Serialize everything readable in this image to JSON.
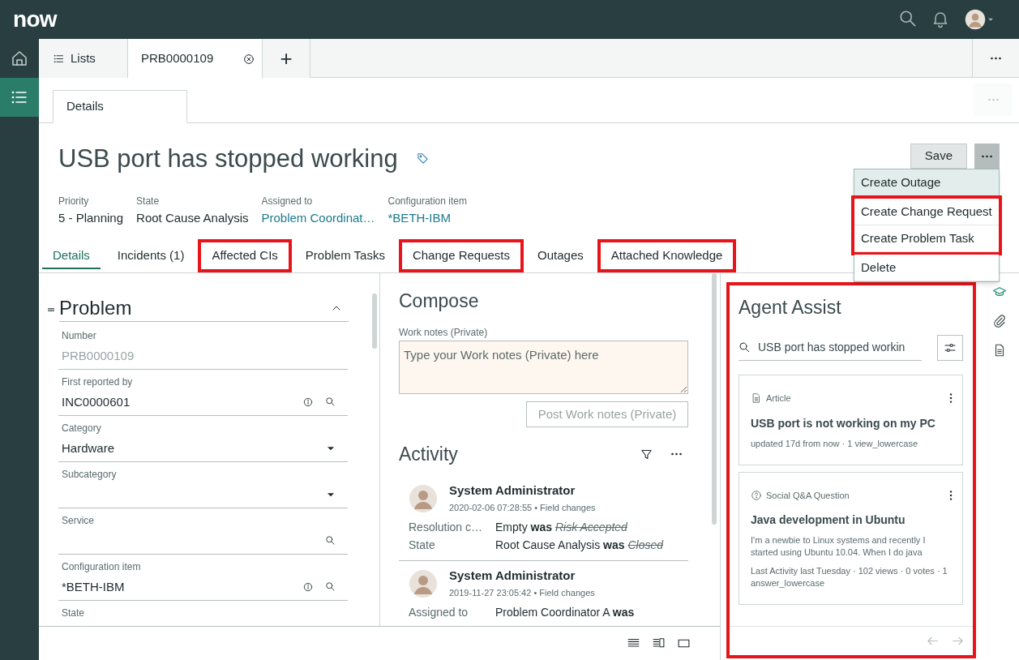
{
  "app": {
    "logo": "now"
  },
  "nav_rail": [
    {
      "kind": "home",
      "selected": false
    },
    {
      "kind": "list",
      "selected": true
    }
  ],
  "workspace_tabs": [
    {
      "kind": "list",
      "label": "Lists",
      "selected": false
    },
    {
      "kind": "record",
      "label": "PRB0000109",
      "selected": true
    },
    {
      "kind": "add",
      "label": "+",
      "selected": false
    }
  ],
  "page_tabs": [
    {
      "label": "Details",
      "selected": true
    }
  ],
  "record": {
    "title": "USB port has stopped working",
    "save_button": "Save",
    "fields": [
      {
        "label": "Priority",
        "value": "5 - Planning",
        "kind": "text"
      },
      {
        "label": "State",
        "value": "Root Cause Analysis",
        "kind": "text"
      },
      {
        "label": "Assigned to",
        "value": "Problem Coordinat…",
        "kind": "link"
      },
      {
        "label": "Configuration item",
        "value": "*BETH-IBM",
        "kind": "link"
      }
    ]
  },
  "action_menu": [
    {
      "label": "Create Outage",
      "hovered": true,
      "outlined": false
    },
    {
      "label": "Create Change Request",
      "hovered": false,
      "outlined": true
    },
    {
      "label": "Create Problem Task",
      "hovered": false,
      "outlined": true
    },
    {
      "label": "Delete",
      "hovered": false,
      "outlined": false
    }
  ],
  "record_tabs": [
    {
      "label": "Details",
      "selected": true,
      "outlined": false
    },
    {
      "label": "Incidents (1)",
      "selected": false,
      "outlined": false
    },
    {
      "label": "Affected CIs",
      "selected": false,
      "outlined": true
    },
    {
      "label": "Problem Tasks",
      "selected": false,
      "outlined": false
    },
    {
      "label": "Change Requests",
      "selected": false,
      "outlined": true
    },
    {
      "label": "Outages",
      "selected": false,
      "outlined": false
    },
    {
      "label": "Attached Knowledge",
      "selected": false,
      "outlined": true
    }
  ],
  "form": {
    "section": "Problem",
    "expanded": true,
    "fields": [
      {
        "label": "Number",
        "value": "PRB0000109",
        "kind": "readonly"
      },
      {
        "label": "First reported by",
        "value": "INC0000601",
        "kind": "reference"
      },
      {
        "label": "Category",
        "value": "Hardware",
        "kind": "choice"
      },
      {
        "label": "Subcategory",
        "kind": "choice"
      },
      {
        "label": "Service",
        "kind": "lookup"
      },
      {
        "label": "Configuration item",
        "value": "*BETH-IBM",
        "kind": "reference"
      },
      {
        "label": "State",
        "kind": "label_only"
      }
    ]
  },
  "compose": {
    "title": "Compose",
    "field_label": "Work notes (Private)",
    "placeholder": "Type your Work notes (Private) here",
    "post_button": "Post Work notes (Private)",
    "post_disabled": true
  },
  "activity": {
    "title": "Activity",
    "entries": [
      {
        "author": "System Administrator",
        "timestamp": "2020-02-06 07:28:55 • Field changes",
        "changes": [
          {
            "field": "Resolution c…",
            "new": "Empty",
            "connector": "was",
            "old": "Risk Accepted"
          },
          {
            "field": "State",
            "new": "Root Cause Analysis",
            "connector": "was",
            "old": "Closed"
          }
        ]
      },
      {
        "author": "System Administrator",
        "timestamp": "2019-11-27 23:05:42 • Field changes",
        "changes": [
          {
            "field": "Assigned to",
            "new": "Problem Coordinator A",
            "connector": "was"
          }
        ]
      }
    ]
  },
  "agent_assist": {
    "title": "Agent Assist",
    "outlined": true,
    "search_value": "USB port has stopped workin",
    "results": [
      {
        "kind": "article",
        "type": "Article",
        "title": "USB port is not working on my PC",
        "meta": "updated 17d from now · 1 view_lowercase"
      },
      {
        "kind": "question",
        "type": "Social Q&A Question",
        "title": "Java development in Ubuntu",
        "snippet": "I'm a newbie to Linux systems and recently I started using Ubuntu 10.04. When I do java",
        "meta": "Last Activity last Tuesday · 102 views · 0 votes · 1 answer_lowercase"
      }
    ]
  },
  "side_tools": [
    {
      "kind": "knowledge",
      "selected": true
    },
    {
      "kind": "attachment",
      "selected": false
    },
    {
      "kind": "document",
      "selected": false
    }
  ]
}
